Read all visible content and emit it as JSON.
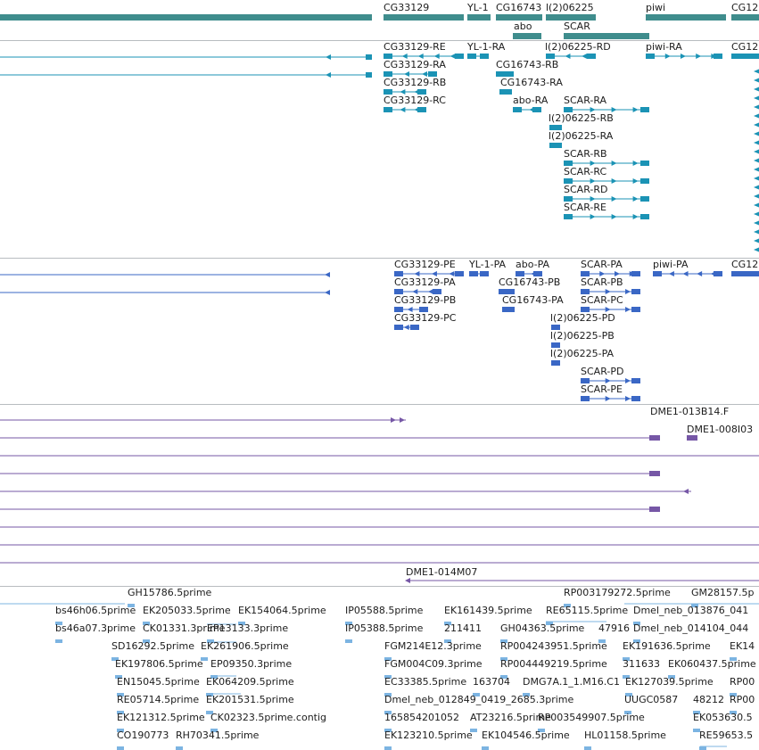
{
  "genes": [
    {
      "label": "CG33129"
    },
    {
      "label": "YL-1"
    },
    {
      "label": "CG16743"
    },
    {
      "label": "l(2)06225"
    },
    {
      "label": "piwi"
    },
    {
      "label": "CG12"
    },
    {
      "label": "abo"
    },
    {
      "label": "SCAR"
    }
  ],
  "flybase_transcripts": [
    "CG33129-RE",
    "YL-1-RA",
    "l(2)06225-RD",
    "piwi-RA",
    "CG12",
    "CG33129-RA",
    "CG16743-RB",
    "CG33129-RB",
    "CG16743-RA",
    "CG33129-RC",
    "abo-RA",
    "SCAR-RA",
    "l(2)06225-RB",
    "l(2)06225-RA",
    "SCAR-RB",
    "SCAR-RC",
    "SCAR-RD",
    "SCAR-RE"
  ],
  "flybase_proteins": [
    "CG33129-PE",
    "YL-1-PA",
    "abo-PA",
    "SCAR-PA",
    "piwi-PA",
    "CG12",
    "CG33129-PA",
    "CG16743-PB",
    "SCAR-PB",
    "CG33129-PB",
    "CG16743-PA",
    "SCAR-PC",
    "CG33129-PC",
    "l(2)06225-PD",
    "l(2)06225-PB",
    "l(2)06225-PA",
    "SCAR-PD",
    "SCAR-PE"
  ],
  "bac_clones": [
    "DME1-013B14.F",
    "DME1-008I03",
    "DME1-014M07"
  ],
  "ests": [
    "GH15786.5prime",
    "RP003179272.5prime",
    "GM28157.5p",
    "bs46h06.5prime",
    "EK205033.5prime",
    "EK154064.5prime",
    "IP05588.5prime",
    "EK161439.5prime",
    "RE65115.5prime",
    "Dmel_neb_013876_041",
    "bs46a07.3prime",
    "CK01331.3prime",
    "EP13133.3prime",
    "IP05388.5prime",
    "211411",
    "GH04363.5prime",
    "47916",
    "Dmel_neb_014104_044",
    "SD16292.5prime",
    "EK261906.5prime",
    "FGM214E12.3prime",
    "RP004243951.5prime",
    "EK191636.5prime",
    "EK14",
    "EK197806.5prime",
    "EP09350.3prime",
    "FGM004C09.3prime",
    "RP004449219.5prime",
    "311633",
    "EK060437.5prime",
    "EN15045.5prime",
    "EK064209.5prime",
    "EC33385.5prime",
    "163704",
    "DMG7A.1_1.M16.C1",
    "EK127039.5prime",
    "RP00",
    "RE05714.5prime",
    "EK201531.5prime",
    "Dmel_neb_012849_0419_2685.3prime",
    "UUGC0587",
    "48212",
    "RP00",
    "EK121312.5prime",
    "CK02323.5prime.contig",
    "165854201052",
    "AT23216.5prime",
    "RP003549907.5prime",
    "EK053630.5",
    "CO190773",
    "RH70341.5prime",
    "EK123210.5prime",
    "EK104546.5prime",
    "HL01158.5prime",
    "RE59653.5"
  ],
  "colors": {
    "gene": "#3f8d8d",
    "transcript": "#1b93b5",
    "protein": "#3a67c5",
    "clone": "#7657a6",
    "est": "#7cb4e2",
    "separator": "#b8bcc0"
  }
}
